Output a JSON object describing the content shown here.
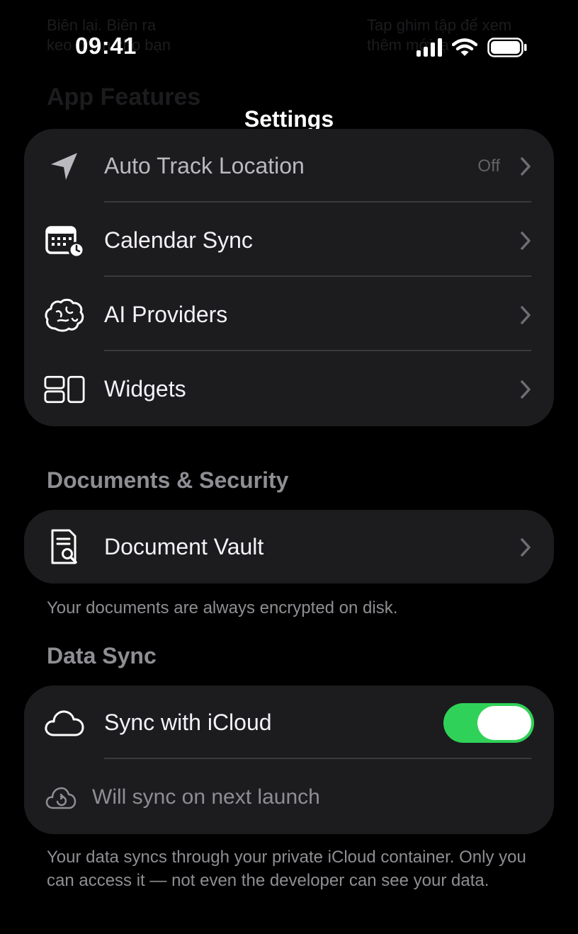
{
  "status_bar": {
    "time": "09:41"
  },
  "background_ghost": {
    "top_left": "Biên lại. Biên ra\nkeo phần cho bạn",
    "top_right": "Tap ghim tập để xem\nthêm mới lạ",
    "heading": "App Features"
  },
  "nav": {
    "title": "Settings"
  },
  "app_features": {
    "items": [
      {
        "label": "Auto Track Location",
        "value": "Off",
        "icon": "location-arrow-icon"
      },
      {
        "label": "Calendar Sync",
        "icon": "calendar-clock-icon"
      },
      {
        "label": "AI Providers",
        "icon": "brain-icon"
      },
      {
        "label": "Widgets",
        "icon": "widgets-icon"
      }
    ]
  },
  "documents_security": {
    "header": "Documents & Security",
    "items": [
      {
        "label": "Document Vault",
        "icon": "document-search-icon"
      }
    ],
    "footer": "Your documents are always encrypted on disk."
  },
  "data_sync": {
    "header": "Data Sync",
    "toggle_label": "Sync with iCloud",
    "toggle_on": true,
    "status_text": "Will sync on next launch",
    "footer": "Your data syncs through your private iCloud container. Only you can access it — not even the developer can see your data."
  },
  "colors": {
    "background": "#000000",
    "card": "#1c1c1e",
    "divider": "#3a3a3c",
    "secondary_text": "#8e8e93",
    "toggle_on": "#30d158"
  }
}
